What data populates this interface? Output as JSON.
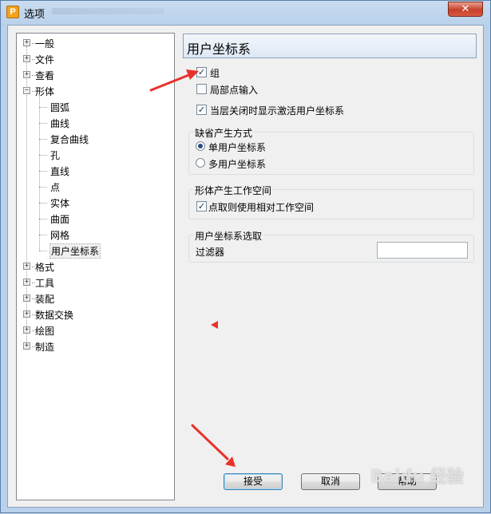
{
  "window": {
    "title": "选项",
    "app_icon_letter": "P",
    "close_glyph": "✕"
  },
  "tree": {
    "expander_closed": "+",
    "expander_open": "−",
    "items": [
      {
        "label": "一般"
      },
      {
        "label": "文件"
      },
      {
        "label": "查看"
      },
      {
        "label": "形体",
        "expanded": true,
        "children": [
          {
            "label": "圆弧"
          },
          {
            "label": "曲线"
          },
          {
            "label": "复合曲线"
          },
          {
            "label": "孔"
          },
          {
            "label": "直线"
          },
          {
            "label": "点"
          },
          {
            "label": "实体"
          },
          {
            "label": "曲面"
          },
          {
            "label": "网格"
          },
          {
            "label": "用户坐标系",
            "selected": true
          }
        ]
      },
      {
        "label": "格式"
      },
      {
        "label": "工具"
      },
      {
        "label": "装配"
      },
      {
        "label": "数据交换"
      },
      {
        "label": "绘图"
      },
      {
        "label": "制造"
      }
    ]
  },
  "panel": {
    "title": "用户坐标系",
    "check_group": {
      "label": "组",
      "checked": true
    },
    "check_local_point": {
      "label": "局部点输入",
      "checked": false
    },
    "check_show_active": {
      "label": "当层关闭时显示激活用户坐标系",
      "checked": true
    },
    "default_mode": {
      "title": "缺省产生方式",
      "options": [
        {
          "label": "单用户坐标系",
          "selected": true
        },
        {
          "label": "多用户坐标系",
          "selected": false
        }
      ]
    },
    "workspace": {
      "title": "形体产生工作空间",
      "check_relative": {
        "label": "点取则使用相对工作空间",
        "checked": true
      }
    },
    "ucs_select": {
      "title": "用户坐标系选取",
      "filter_label": "过滤器",
      "filter_value": ""
    }
  },
  "buttons": {
    "accept": "接受",
    "cancel": "取消",
    "help": "帮助"
  },
  "check_glyph": "✓",
  "watermark": "Baidu 经验",
  "colors": {
    "annotation_arrow": "#e8322b",
    "selection_dot": "#2c4b83",
    "title_gradient_top": "#c9dcf1"
  }
}
